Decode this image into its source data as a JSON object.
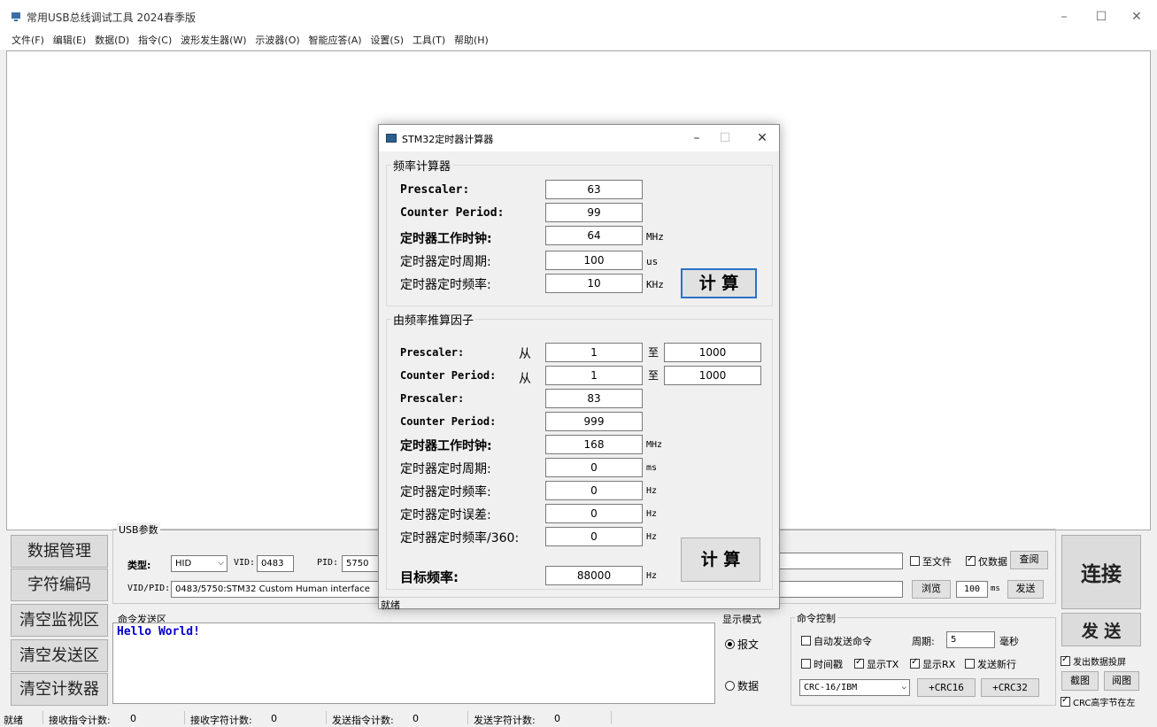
{
  "window": {
    "title": "常用USB总线调试工具 2024春季版",
    "min": "–",
    "max": "☐",
    "close": "✕"
  },
  "menu": [
    "文件(F)",
    "编辑(E)",
    "数据(D)",
    "指令(C)",
    "波形发生器(W)",
    "示波器(O)",
    "智能应答(A)",
    "设置(S)",
    "工具(T)",
    "帮助(H)"
  ],
  "left_buttons": {
    "data_manage": "数据管理",
    "char_encode": "字符编码",
    "clear_monitor": "清空监视区",
    "clear_send": "清空发送区",
    "clear_counter": "清空计数器"
  },
  "usb": {
    "group_label": "USB参数",
    "type_label": "类型:",
    "type_value": "HID",
    "vid_label": "VID:",
    "vid_value": "0483",
    "pid_label": "PID:",
    "pid_value": "5750",
    "vidpid_label": "VID/PID:",
    "vidpid_value": "0483/5750:STM32 Custom Human interface"
  },
  "file_area": {
    "to_file": "至文件",
    "data_only": "仅数据",
    "query": "查阅",
    "browse": "浏览",
    "interval_value": "100",
    "interval_unit": "ms",
    "send": "发送"
  },
  "connect": "连接",
  "send_area": {
    "label": "命令发送区",
    "text": "Hello World!"
  },
  "display_mode": {
    "label": "显示模式",
    "message": "报文",
    "data": "数据"
  },
  "cmd_control": {
    "label": "命令控制",
    "auto_send": "自动发送命令",
    "period_label": "周期:",
    "period_value": "5",
    "period_unit": "毫秒",
    "timestamp": "时间戳",
    "show_tx": "显示TX",
    "show_rx": "显示RX",
    "send_newline": "发送新行",
    "crc_select": "CRC-16/IBM",
    "add_crc16": "+CRC16",
    "add_crc32": "+CRC32"
  },
  "send_button": "发 送",
  "right_options": {
    "project_data": "发出数据投屏",
    "screenshot": "截图",
    "view_image": "阅图",
    "crc_high_first": "CRC高字节在左"
  },
  "status_bar": {
    "ready": "就绪",
    "recv_cmd_label": "接收指令计数:",
    "recv_cmd_value": "0",
    "recv_char_label": "接收字符计数:",
    "recv_char_value": "0",
    "send_cmd_label": "发送指令计数:",
    "send_cmd_value": "0",
    "send_char_label": "发送字符计数:",
    "send_char_value": "0"
  },
  "dialog": {
    "title": "STM32定时器计算器",
    "min": "–",
    "max": "☐",
    "close": "✕",
    "freq_calc": {
      "label": "频率计算器",
      "prescaler_label": "Prescaler:",
      "prescaler_value": "63",
      "period_label": "Counter Period:",
      "period_value": "99",
      "clock_label": "定时器工作时钟:",
      "clock_value": "64",
      "clock_unit": "MHz",
      "timer_period_label": "定时器定时周期:",
      "timer_period_value": "100",
      "timer_period_unit": "us",
      "timer_freq_label": "定时器定时频率:",
      "timer_freq_value": "10",
      "timer_freq_unit": "KHz",
      "calc_button": "计 算"
    },
    "factor_calc": {
      "label": "由频率推算因子",
      "prescaler_range_label": "Prescaler:",
      "from": "从",
      "to": "至",
      "prescaler_from": "1",
      "prescaler_to": "1000",
      "period_range_label": "Counter Period:",
      "period_from": "1",
      "period_to": "1000",
      "prescaler_label": "Prescaler:",
      "prescaler_value": "83",
      "period_label": "Counter Period:",
      "period_value": "999",
      "clock_label": "定时器工作时钟:",
      "clock_value": "168",
      "clock_unit": "MHz",
      "timer_period_label": "定时器定时周期:",
      "timer_period_value": "0",
      "timer_period_unit": "ms",
      "timer_freq_label": "定时器定时频率:",
      "timer_freq_value": "0",
      "timer_freq_unit": "Hz",
      "timer_err_label": "定时器定时误差:",
      "timer_err_value": "0",
      "timer_err_unit": "Hz",
      "timer_freq360_label": "定时器定时频率/360:",
      "timer_freq360_value": "0",
      "timer_freq360_unit": "Hz",
      "target_label": "目标频率:",
      "target_value": "88000",
      "target_unit": "Hz",
      "calc_button": "计 算"
    },
    "status": "就绪"
  }
}
